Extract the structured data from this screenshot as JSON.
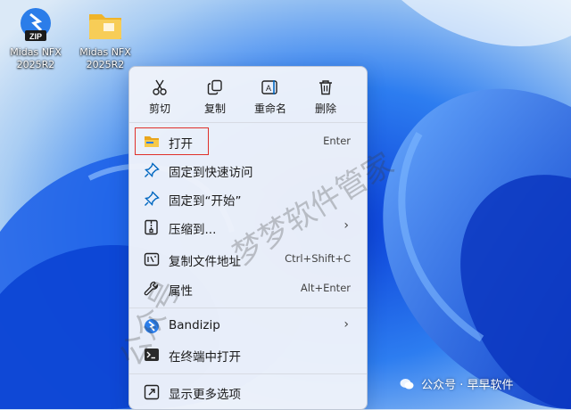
{
  "desktop": {
    "icons": [
      {
        "label": "Midas NFX 2025R2",
        "icon": "zip-file-icon"
      },
      {
        "label": "Midas NFX 2025R2",
        "icon": "folder-icon"
      }
    ]
  },
  "menu": {
    "actions": [
      {
        "label": "剪切",
        "icon": "scissors-icon"
      },
      {
        "label": "复制",
        "icon": "copy-icon"
      },
      {
        "label": "重命名",
        "icon": "rename-icon"
      },
      {
        "label": "删除",
        "icon": "trash-icon"
      }
    ],
    "items": [
      {
        "label": "打开",
        "shortcut": "Enter",
        "icon": "folder-open-icon"
      },
      {
        "label": "固定到快速访问",
        "shortcut": "",
        "icon": "pin-icon"
      },
      {
        "label": "固定到“开始”",
        "shortcut": "",
        "icon": "pin-icon"
      },
      {
        "label": "压缩到...",
        "shortcut": "",
        "icon": "archive-icon",
        "submenu": true
      },
      {
        "label": "复制文件地址",
        "shortcut": "Ctrl+Shift+C",
        "icon": "path-icon"
      },
      {
        "label": "属性",
        "shortcut": "Alt+Enter",
        "icon": "wrench-icon"
      },
      {
        "label": "Bandizip",
        "shortcut": "",
        "icon": "bandizip-icon",
        "submenu": true
      },
      {
        "label": "在终端中打开",
        "shortcut": "",
        "icon": "terminal-icon"
      },
      {
        "label": "显示更多选项",
        "shortcut": "",
        "icon": "more-options-icon"
      }
    ],
    "submenu_arrow": "›"
  },
  "watermark": {
    "line1": "公众号",
    "line2": "梦梦软件管家"
  },
  "badge": {
    "text": "公众号 · 早早软件"
  },
  "colors": {
    "accent": "#0067c0",
    "highlight": "#e0302a",
    "folder": "#f5c542"
  }
}
